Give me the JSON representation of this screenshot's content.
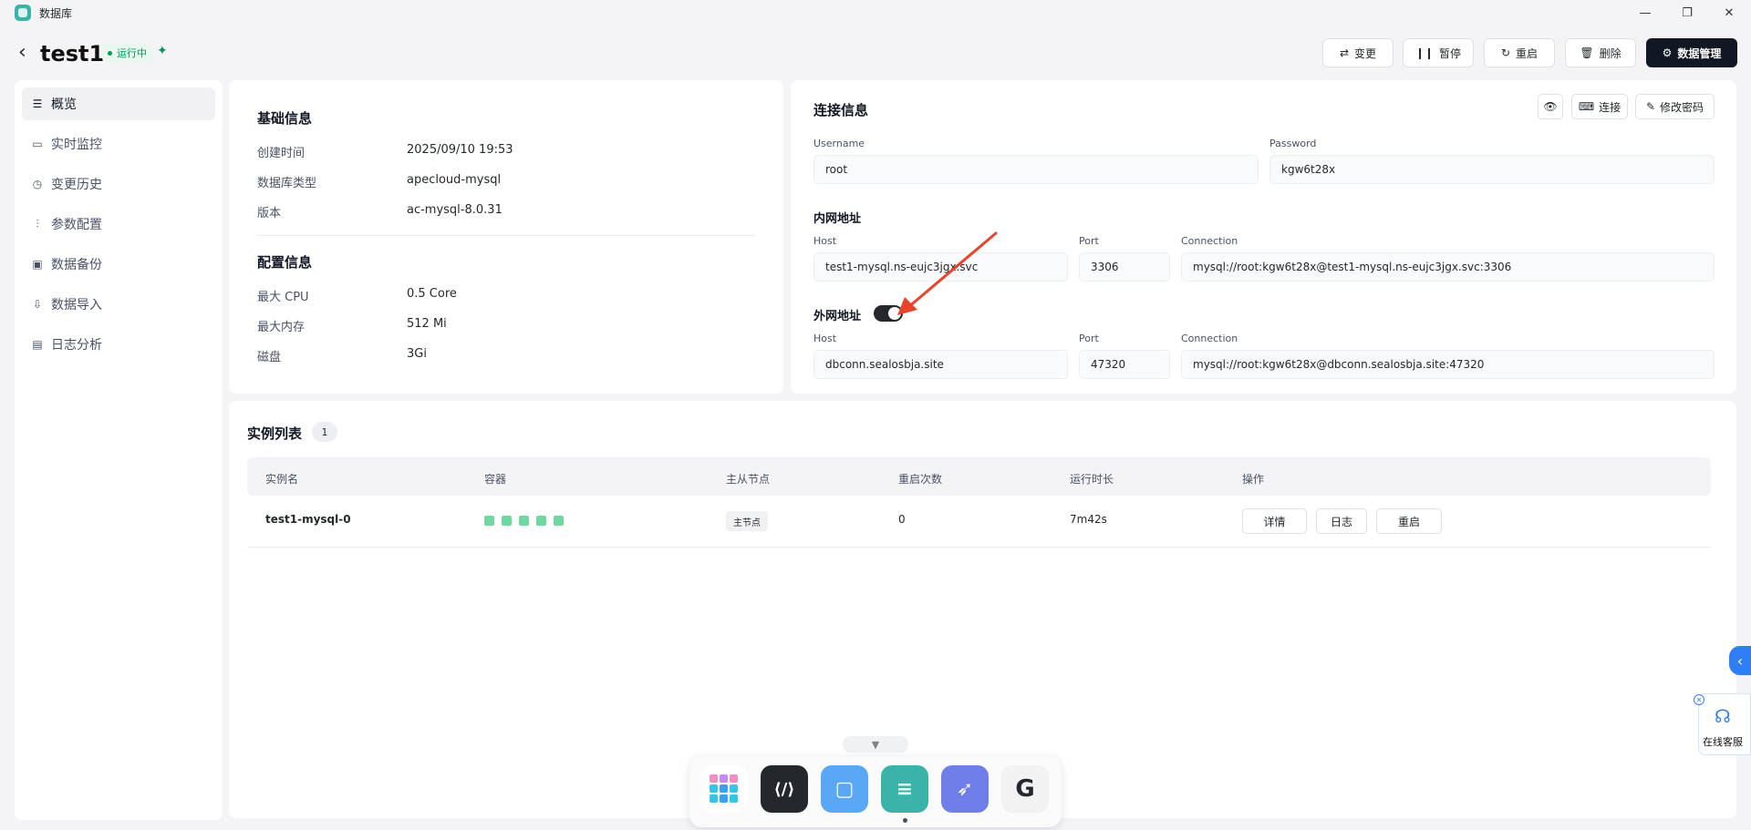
{
  "window": {
    "app_name": "数据库"
  },
  "header": {
    "title": "test1",
    "status": "运行中",
    "buttons": {
      "change": "变更",
      "pause": "暂停",
      "restart": "重启",
      "delete": "删除",
      "manage": "数据管理"
    }
  },
  "sidebar": {
    "items": [
      {
        "label": "概览",
        "icon": "overview-icon"
      },
      {
        "label": "实时监控",
        "icon": "monitor-icon"
      },
      {
        "label": "变更历史",
        "icon": "history-icon"
      },
      {
        "label": "参数配置",
        "icon": "params-icon"
      },
      {
        "label": "数据备份",
        "icon": "backup-icon"
      },
      {
        "label": "数据导入",
        "icon": "import-icon"
      },
      {
        "label": "日志分析",
        "icon": "log-icon"
      }
    ]
  },
  "basic": {
    "title": "基础信息",
    "rows": [
      {
        "k": "创建时间",
        "v": "2025/09/10 19:53"
      },
      {
        "k": "数据库类型",
        "v": "apecloud-mysql"
      },
      {
        "k": "版本",
        "v": "ac-mysql-8.0.31"
      }
    ],
    "config_title": "配置信息",
    "config_rows": [
      {
        "k": "最大 CPU",
        "v": "0.5 Core"
      },
      {
        "k": "最大内存",
        "v": "512 Mi"
      },
      {
        "k": "磁盘",
        "v": "3Gi"
      }
    ]
  },
  "connection": {
    "title": "连接信息",
    "connect_label": "连接",
    "change_pw_label": "修改密码",
    "username_label": "Username",
    "username": "root",
    "password_label": "Password",
    "password": "kgw6t28x",
    "internal": {
      "title": "内网地址",
      "host_label": "Host",
      "host": "test1-mysql.ns-eujc3jgx.svc",
      "port_label": "Port",
      "port": "3306",
      "conn_label": "Connection",
      "conn": "mysql://root:kgw6t28x@test1-mysql.ns-eujc3jgx.svc:3306"
    },
    "external": {
      "title": "外网地址",
      "enabled": true,
      "host_label": "Host",
      "host": "dbconn.sealosbja.site",
      "port_label": "Port",
      "port": "47320",
      "conn_label": "Connection",
      "conn": "mysql://root:kgw6t28x@dbconn.sealosbja.site:47320"
    }
  },
  "instances": {
    "title": "实例列表",
    "count": "1",
    "columns": [
      "实例名",
      "容器",
      "主从节点",
      "重启次数",
      "运行时长",
      "操作"
    ],
    "rows": [
      {
        "name": "test1-mysql-0",
        "containers_ok": 5,
        "role": "主节点",
        "restarts": "0",
        "uptime": "7m42s",
        "actions": [
          "详情",
          "日志",
          "重启"
        ]
      }
    ]
  },
  "support": {
    "label": "在线客服"
  },
  "colors": {
    "accent_dark": "#111824",
    "running_green": "#039855",
    "container_ok": "#6ed8a0",
    "arrow_annotation": "#e8442b"
  }
}
